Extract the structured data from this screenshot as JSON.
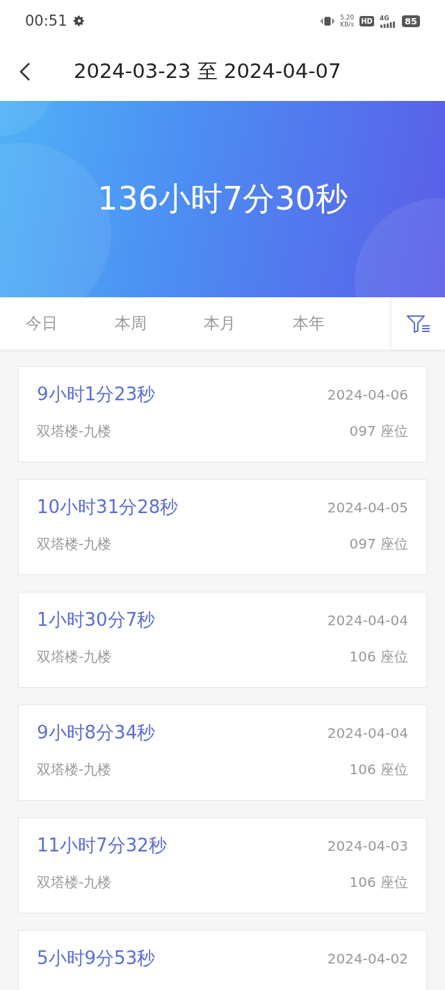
{
  "status_bar": {
    "time": "00:51",
    "speed_value": "5.20",
    "speed_unit": "KB/s",
    "hd": "HD",
    "network": "4G",
    "battery": "85"
  },
  "header": {
    "title": "2024-03-23 至 2024-04-07"
  },
  "banner": {
    "total": "136小时7分30秒"
  },
  "tabs": [
    {
      "label": "今日"
    },
    {
      "label": "本周"
    },
    {
      "label": "本月"
    },
    {
      "label": "本年"
    }
  ],
  "records": [
    {
      "duration": "9小时1分23秒",
      "date": "2024-04-06",
      "place": "双塔楼-九楼",
      "seat": "097 座位"
    },
    {
      "duration": "10小时31分28秒",
      "date": "2024-04-05",
      "place": "双塔楼-九楼",
      "seat": "097 座位"
    },
    {
      "duration": "1小时30分7秒",
      "date": "2024-04-04",
      "place": "双塔楼-九楼",
      "seat": "106 座位"
    },
    {
      "duration": "9小时8分34秒",
      "date": "2024-04-04",
      "place": "双塔楼-九楼",
      "seat": "106 座位"
    },
    {
      "duration": "11小时7分32秒",
      "date": "2024-04-03",
      "place": "双塔楼-九楼",
      "seat": "106 座位"
    },
    {
      "duration": "5小时9分53秒",
      "date": "2024-04-02"
    }
  ]
}
